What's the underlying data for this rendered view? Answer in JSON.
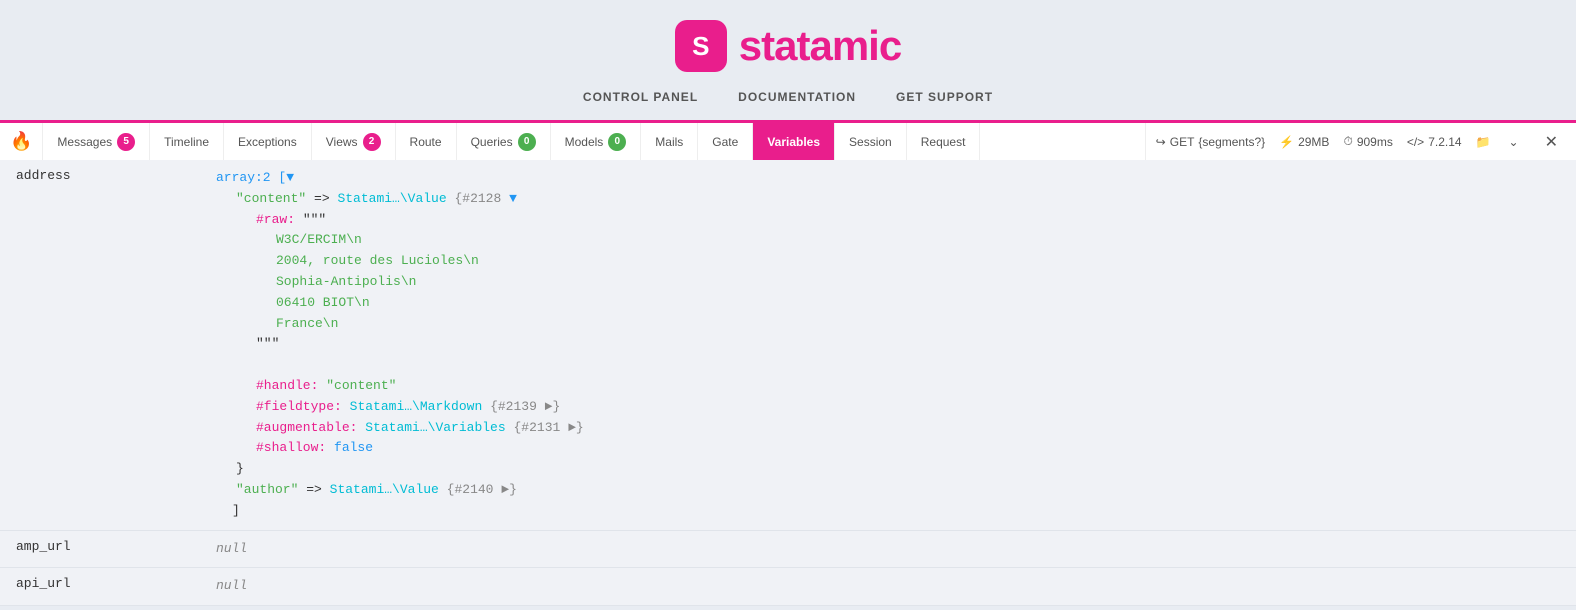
{
  "header": {
    "logo_letter": "S",
    "logo_name": "statamic",
    "nav": [
      {
        "label": "CONTROL PANEL",
        "id": "nav-control-panel"
      },
      {
        "label": "DOCUMENTATION",
        "id": "nav-documentation"
      },
      {
        "label": "GET SUPPORT",
        "id": "nav-get-support"
      }
    ]
  },
  "debugbar": {
    "tabs": [
      {
        "id": "messages",
        "label": "Messages",
        "badge": "5",
        "badge_color": "pink",
        "active": false
      },
      {
        "id": "timeline",
        "label": "Timeline",
        "badge": null,
        "active": false
      },
      {
        "id": "exceptions",
        "label": "Exceptions",
        "badge": null,
        "active": false
      },
      {
        "id": "views",
        "label": "Views",
        "badge": "2",
        "badge_color": "pink",
        "active": false
      },
      {
        "id": "route",
        "label": "Route",
        "badge": null,
        "active": false
      },
      {
        "id": "queries",
        "label": "Queries",
        "badge": "0",
        "badge_color": "green",
        "active": false
      },
      {
        "id": "models",
        "label": "Models",
        "badge": "0",
        "badge_color": "green",
        "active": false
      },
      {
        "id": "mails",
        "label": "Mails",
        "badge": null,
        "active": false
      },
      {
        "id": "gate",
        "label": "Gate",
        "badge": null,
        "active": false
      },
      {
        "id": "variables",
        "label": "Variables",
        "badge": null,
        "active": true
      },
      {
        "id": "session",
        "label": "Session",
        "badge": null,
        "active": false
      },
      {
        "id": "request",
        "label": "Request",
        "badge": null,
        "active": false
      }
    ],
    "right": {
      "method": "GET",
      "route": "{segments?}",
      "memory": "29MB",
      "time": "909ms",
      "version": "7.2.14"
    }
  },
  "variables": {
    "rows": [
      {
        "key": "address",
        "value_type": "complex"
      },
      {
        "key": "amp_url",
        "value": "null"
      },
      {
        "key": "api_url",
        "value": "null"
      }
    ],
    "address_detail": {
      "array_label": "array:2 [▼",
      "content_key": "\"content\"",
      "content_arrow": "=>",
      "content_class": "Statami…\\Value",
      "content_id": "{#2128 ▼",
      "raw_label": "#raw:",
      "raw_open": "\"\"\"",
      "raw_lines": [
        "W3C/ERCIM\\n",
        "2004, route des Lucioles\\n",
        "Sophia-Antipolis\\n",
        "06410 BIOT\\n",
        "France\\n"
      ],
      "raw_close": "\"\"\"",
      "handle_label": "#handle:",
      "handle_value": "\"content\"",
      "fieldtype_label": "#fieldtype:",
      "fieldtype_class": "Statami…\\Markdown",
      "fieldtype_id": "{#2139 ►}",
      "augmentable_label": "#augmentable:",
      "augmentable_class": "Statami…\\Variables",
      "augmentable_id": "{#2131 ►}",
      "shallow_label": "#shallow:",
      "shallow_value": "false",
      "close_brace": "}",
      "author_key": "\"author\"",
      "author_arrow": "=>",
      "author_class": "Statami…\\Value",
      "author_id": "{#2140 ►}",
      "array_close": "]"
    }
  },
  "icons": {
    "fire": "🔥",
    "arrow_right": "↪",
    "memory": "⚡",
    "clock": "⏱",
    "code": "</>",
    "folder": "📁",
    "chevron_down": "⌄",
    "close": "✕"
  }
}
